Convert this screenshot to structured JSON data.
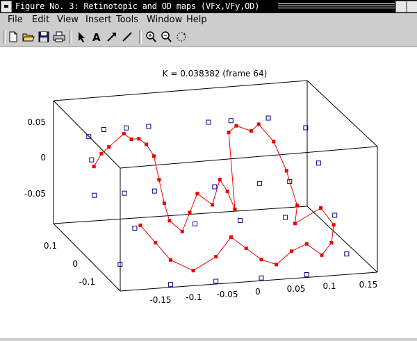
{
  "window": {
    "title": "Figure No. 3: Retinotopic and OD maps (VFx,VFy,OD)"
  },
  "menu": [
    {
      "label": "File"
    },
    {
      "label": "Edit"
    },
    {
      "label": "View"
    },
    {
      "label": "Insert"
    },
    {
      "label": "Tools"
    },
    {
      "label": "Window"
    },
    {
      "label": "Help"
    }
  ],
  "toolbar": {
    "buttons": [
      "new-file-icon",
      "open-folder-icon",
      "save-icon",
      "print-icon",
      "select-arrow-icon",
      "insert-text-icon",
      "insert-arrow-icon",
      "insert-line-icon",
      "zoom-in-icon",
      "zoom-out-icon",
      "rotate-3d-icon"
    ]
  },
  "colors": {
    "red_series": "#ee0000",
    "blue_series": "#00008b"
  },
  "chart_data": {
    "type": "scatter",
    "title": "K = 0.038382 (frame 64)",
    "z_ticks": [
      "0.05",
      "0",
      "-0.05"
    ],
    "y_ticks": [
      "0.1",
      "0",
      "-0.1"
    ],
    "x_ticks": [
      "-0.15",
      "-0.1",
      "-0.05",
      "0",
      "0.05",
      "0.1",
      "0.15"
    ],
    "projection": "3-D box view",
    "series": [
      {
        "marker": "filled-square-with-lines",
        "color": "#ee0000",
        "points": [
          [
            -0.14,
            0.06,
            0.02
          ],
          [
            -0.13,
            0.06,
            0.04
          ],
          [
            -0.12,
            0.06,
            0.05
          ],
          [
            -0.1,
            0.06,
            0.07
          ],
          [
            -0.09,
            0.06,
            0.06
          ],
          [
            -0.08,
            0.06,
            0.06
          ],
          [
            -0.07,
            0.06,
            0.05
          ],
          [
            -0.06,
            0.06,
            0.03
          ],
          [
            -0.06,
            0.04,
            0.0
          ],
          [
            -0.06,
            0.02,
            -0.03
          ],
          [
            -0.06,
            0.0,
            -0.05
          ],
          [
            -0.05,
            -0.02,
            -0.06
          ],
          [
            -0.04,
            -0.02,
            -0.03
          ],
          [
            -0.03,
            -0.02,
            0.0
          ],
          [
            -0.01,
            -0.02,
            -0.02
          ],
          [
            0.0,
            -0.02,
            0.02
          ],
          [
            0.01,
            -0.02,
            0.0
          ],
          [
            0.02,
            -0.02,
            -0.03
          ],
          [
            0.04,
            0.06,
            0.06
          ],
          [
            0.05,
            0.06,
            0.07
          ],
          [
            0.07,
            0.06,
            0.06
          ],
          [
            0.08,
            0.06,
            0.07
          ],
          [
            0.1,
            0.06,
            0.04
          ],
          [
            0.11,
            0.04,
            0.0
          ],
          [
            0.11,
            0.0,
            -0.04
          ],
          [
            0.1,
            -0.02,
            -0.06
          ],
          [
            0.12,
            -0.06,
            -0.02
          ],
          [
            0.13,
            -0.08,
            -0.04
          ],
          [
            0.12,
            -0.1,
            -0.06
          ],
          [
            0.1,
            -0.12,
            -0.07
          ],
          [
            0.08,
            -0.12,
            -0.05
          ],
          [
            0.06,
            -0.12,
            -0.06
          ],
          [
            0.04,
            -0.12,
            -0.08
          ],
          [
            0.02,
            -0.12,
            -0.07
          ],
          [
            0.0,
            -0.12,
            -0.05
          ],
          [
            -0.02,
            -0.12,
            -0.03
          ],
          [
            -0.04,
            -0.12,
            -0.06
          ],
          [
            -0.07,
            -0.12,
            -0.08
          ],
          [
            -0.1,
            -0.12,
            -0.06
          ],
          [
            -0.12,
            -0.12,
            -0.03
          ],
          [
            -0.14,
            -0.12,
            0.0
          ]
        ]
      },
      {
        "marker": "open-square",
        "color": "#00008b",
        "points": [
          [
            -0.14,
            0.08,
            0.06
          ],
          [
            -0.12,
            0.08,
            0.07
          ],
          [
            -0.09,
            0.08,
            0.07
          ],
          [
            -0.06,
            0.08,
            0.07
          ],
          [
            0.02,
            0.08,
            0.07
          ],
          [
            0.05,
            0.08,
            0.07
          ],
          [
            0.1,
            0.08,
            0.07
          ],
          [
            0.15,
            0.08,
            0.05
          ],
          [
            0.16,
            0.06,
            0.0
          ],
          [
            0.16,
            0.0,
            -0.06
          ],
          [
            0.14,
            -0.1,
            -0.08
          ],
          [
            -0.16,
            -0.1,
            -0.07
          ],
          [
            -0.16,
            0.0,
            0.0
          ],
          [
            -0.15,
            0.04,
            0.04
          ],
          [
            -0.12,
            0.0,
            0.0
          ],
          [
            -0.08,
            0.0,
            0.0
          ],
          [
            0.0,
            0.0,
            0.0
          ],
          [
            0.06,
            0.0,
            0.0
          ],
          [
            0.1,
            0.0,
            0.0
          ],
          [
            -0.12,
            -0.04,
            -0.04
          ],
          [
            -0.04,
            -0.04,
            -0.04
          ],
          [
            0.02,
            -0.04,
            -0.04
          ],
          [
            0.08,
            -0.04,
            -0.04
          ],
          [
            -0.1,
            -0.12,
            -0.1
          ],
          [
            -0.04,
            -0.12,
            -0.1
          ],
          [
            0.02,
            -0.12,
            -0.1
          ],
          [
            0.08,
            -0.12,
            -0.1
          ]
        ]
      }
    ]
  }
}
